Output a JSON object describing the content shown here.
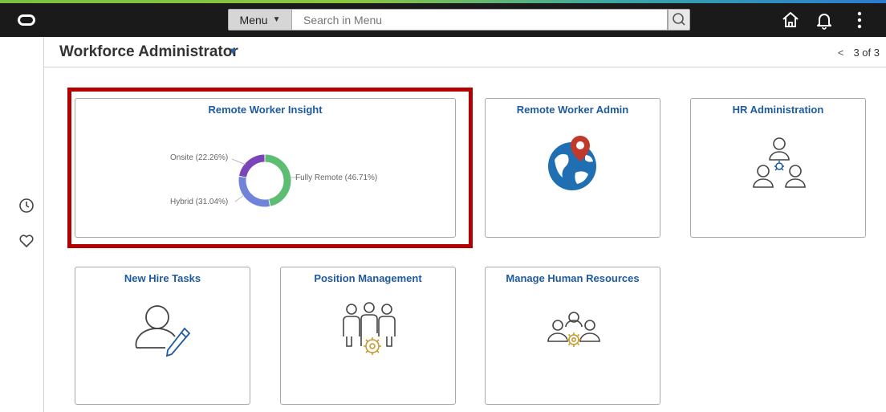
{
  "header": {
    "menu_label": "Menu",
    "search": {
      "placeholder": "Search in Menu",
      "value": ""
    },
    "icons": [
      "oracle-logo-icon",
      "search-icon",
      "home-icon",
      "bell-icon",
      "more-vertical-icon"
    ]
  },
  "left_rail": {
    "icons": [
      "clock-icon",
      "heart-icon"
    ]
  },
  "title_bar": {
    "title": "Workforce Administrator",
    "pager": "3 of 3",
    "prev_glyph": "<"
  },
  "tiles": [
    {
      "title": "Remote Worker Insight",
      "highlighted": true
    },
    {
      "title": "Remote Worker Admin",
      "icon": "globe-location-pin-icon"
    },
    {
      "title": "HR Administration",
      "icon": "people-network-icon"
    },
    {
      "title": "New Hire Tasks",
      "icon": "person-pencil-icon"
    },
    {
      "title": "Position Management",
      "icon": "people-gear-icon"
    },
    {
      "title": "Manage Human Resources",
      "icon": "people-gear-handshake-icon"
    }
  ],
  "colors": {
    "accent_blue": "#1e5aa0",
    "highlight": "#b30000",
    "topbar": "#1a1a1a"
  },
  "chart_data": {
    "type": "pie",
    "categories": [
      "Fully Remote",
      "Hybrid",
      "Onsite"
    ],
    "values": [
      46.71,
      31.04,
      22.26
    ],
    "colors": [
      "#5cbd73",
      "#6f84d8",
      "#7a45b8"
    ],
    "labels": [
      "Fully Remote (46.71%)",
      "Hybrid (31.04%)",
      "Onsite (22.26%)"
    ]
  }
}
